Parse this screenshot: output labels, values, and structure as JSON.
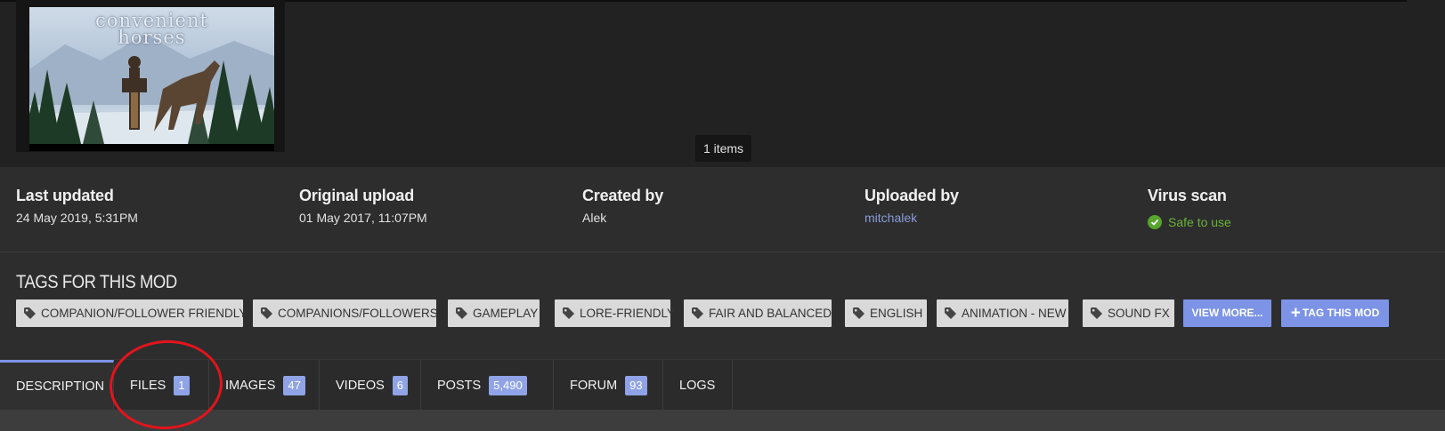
{
  "gallery": {
    "thumbnail_title_line1": "convenient",
    "thumbnail_title_line2": "horses",
    "items_count": "1 items"
  },
  "stats": {
    "last_updated": {
      "label": "Last updated",
      "value": "24 May 2019,  5:31PM"
    },
    "original_upload": {
      "label": "Original upload",
      "value": "01 May 2017,  11:07PM"
    },
    "created_by": {
      "label": "Created by",
      "value": "Alek"
    },
    "uploaded_by": {
      "label": "Uploaded by",
      "value": "mitchalek"
    },
    "virus_scan": {
      "label": "Virus scan",
      "value": "Safe to use"
    }
  },
  "tags": {
    "title": "TAGS FOR THIS MOD",
    "items": [
      "COMPANION/FOLLOWER FRIENDLY",
      "COMPANIONS/FOLLOWERS",
      "GAMEPLAY",
      "LORE-FRIENDLY",
      "FAIR AND BALANCED",
      "ENGLISH",
      "ANIMATION - NEW",
      "SOUND FX"
    ],
    "view_more": "VIEW MORE...",
    "tag_this_mod": "TAG THIS MOD"
  },
  "tabs": [
    {
      "label": "DESCRIPTION",
      "count": ""
    },
    {
      "label": "FILES",
      "count": "1"
    },
    {
      "label": "IMAGES",
      "count": "47"
    },
    {
      "label": "VIDEOS",
      "count": "6"
    },
    {
      "label": "POSTS",
      "count": "5,490"
    },
    {
      "label": "FORUM",
      "count": "93"
    },
    {
      "label": "LOGS",
      "count": ""
    }
  ],
  "colors": {
    "accent": "#7c93e6",
    "badge": "#8fa3e6",
    "safe_green": "#57a52d",
    "link": "#8a9bd8",
    "annotation_circle": "#e3141d"
  },
  "icons": [
    "tag-icon",
    "check-circle-icon",
    "plus-icon"
  ]
}
